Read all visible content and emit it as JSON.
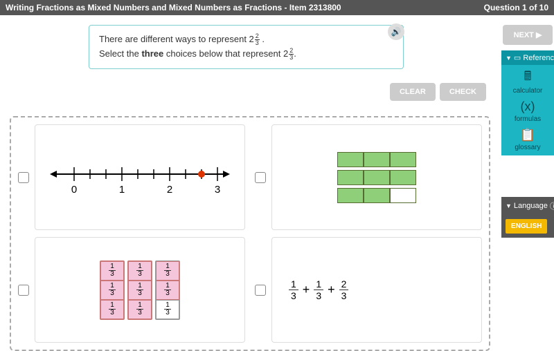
{
  "header": {
    "title": "Writing Fractions as Mixed Numbers and Mixed Numbers as Fractions - Item 2313800",
    "progress": "Question 1 of 10"
  },
  "prompt": {
    "line1_pre": "There are different ways to represent ",
    "mixed_whole": "2",
    "mixed_num": "2",
    "mixed_den": "3",
    "line1_post": " .",
    "line2_pre": "Select the ",
    "line2_bold": "three",
    "line2_mid": " choices below that represent ",
    "line2_post": "."
  },
  "buttons": {
    "clear": "CLEAR",
    "check": "CHECK",
    "next": "NEXT ▶"
  },
  "numberline": {
    "ticks": [
      "0",
      "1",
      "2",
      "3"
    ]
  },
  "fraction_cells": {
    "num": "1",
    "den": "3"
  },
  "equation": {
    "f1n": "1",
    "f1d": "3",
    "op1": "+",
    "f2n": "1",
    "f2d": "3",
    "op2": "+",
    "f3n": "2",
    "f3d": "3"
  },
  "sidebar": {
    "reference": "Reference",
    "calc": "calculator",
    "formulas": "formulas",
    "glossary": "glossary",
    "language": "Language",
    "english": "ENGLISH"
  }
}
